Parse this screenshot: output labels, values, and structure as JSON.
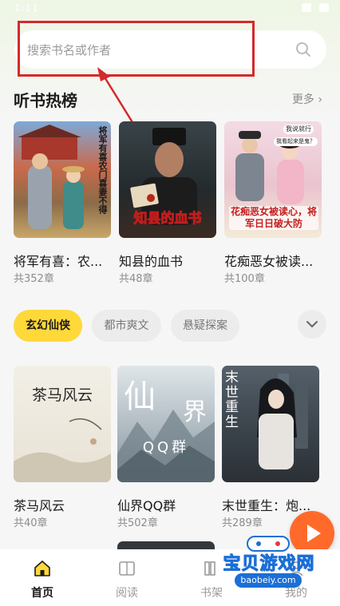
{
  "status_bar": {
    "time": "1:11"
  },
  "search": {
    "placeholder": "搜索书名或作者"
  },
  "hot_section": {
    "title": "听书热榜",
    "more": "更多",
    "books": [
      {
        "title": "将军有喜：农...",
        "chapters": "共352章",
        "cover_text": "将军有喜农门喜妻不得"
      },
      {
        "title": "知县的血书",
        "chapters": "共48章",
        "cover_text": "知县的血书"
      },
      {
        "title": "花痴恶女被读...",
        "chapters": "共100章",
        "cover_text": "花痴恶女被读心，将军日日破大防",
        "cover_bubbles": [
          "我说就行",
          "我看起来是鬼？"
        ]
      }
    ]
  },
  "categories": {
    "tabs": [
      {
        "label": "玄幻仙侠",
        "active": true
      },
      {
        "label": "都市爽文",
        "active": false
      },
      {
        "label": "悬疑探案",
        "active": false
      }
    ]
  },
  "category_books": [
    {
      "title": "茶马风云",
      "chapters": "共40章",
      "cover_text": "茶马风云"
    },
    {
      "title": "仙界QQ群",
      "chapters": "共502章",
      "cover_text_1": "仙",
      "cover_text_2": "界",
      "cover_text_3": "QQ群"
    },
    {
      "title": "末世重生：炮...",
      "chapters": "共289章",
      "cover_text": "末世重生"
    }
  ],
  "bottom_nav": [
    {
      "label": "首页",
      "icon": "home-icon",
      "active": true
    },
    {
      "label": "阅读",
      "icon": "book-open-icon",
      "active": false
    },
    {
      "label": "书架",
      "icon": "bookshelf-icon",
      "active": false
    },
    {
      "label": "我的",
      "icon": "profile-icon",
      "active": false
    }
  ],
  "watermark": {
    "title": "宝贝游戏网",
    "url": "baobeiy.com"
  },
  "colors": {
    "accent": "#ffd83a",
    "fab": "#ff6a2b",
    "annotation": "#d42a2a"
  }
}
